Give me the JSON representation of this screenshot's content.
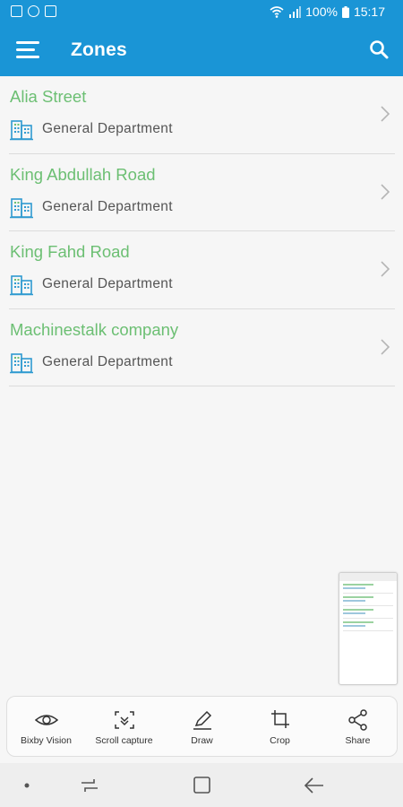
{
  "status_bar": {
    "battery": "100%",
    "time": "15:17",
    "icons": [
      "image-icon",
      "at-sign-icon",
      "gallery-icon",
      "wifi-icon",
      "signal-icon",
      "battery-icon"
    ]
  },
  "app_bar": {
    "title": "Zones",
    "menu_icon": "hamburger-menu-icon",
    "search_icon": "search-icon",
    "color": "#1a95d6"
  },
  "zones": [
    {
      "name": "Alia Street",
      "department": "General Department"
    },
    {
      "name": "King Abdullah Road",
      "department": "General Department"
    },
    {
      "name": "King Fahd Road",
      "department": "General Department"
    },
    {
      "name": "Machinestalk company",
      "department": "General Department"
    }
  ],
  "accent_color": "#6cbf73",
  "capture_toolbar": {
    "bixby_vision": "Bixby Vision",
    "scroll_capture": "Scroll capture",
    "draw": "Draw",
    "crop": "Crop",
    "share": "Share"
  },
  "nav_bar": {
    "items": [
      "dot-icon",
      "recent-apps-icon",
      "home-icon",
      "back-icon"
    ]
  }
}
